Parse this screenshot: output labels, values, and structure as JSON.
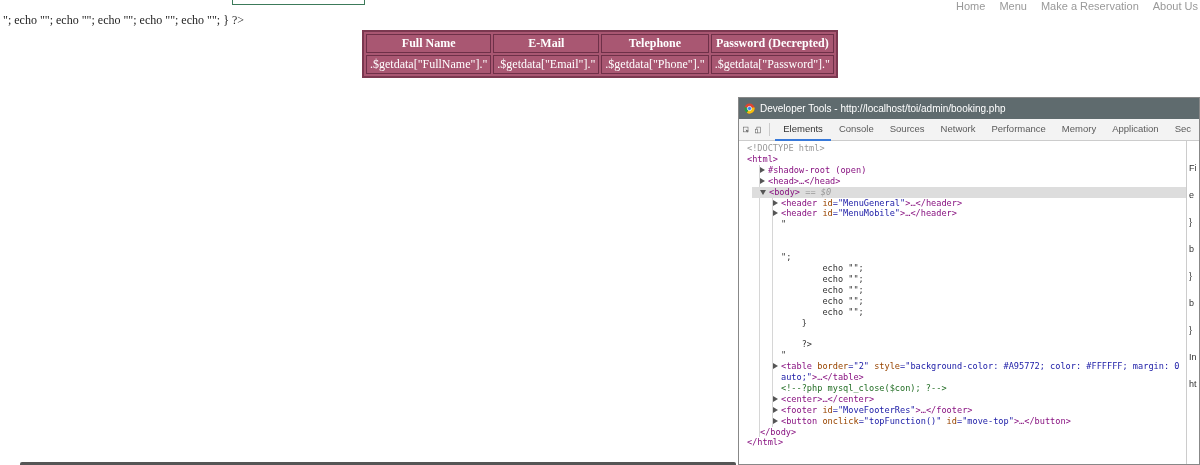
{
  "top_nav": [
    "Home",
    "Menu",
    "Make a Reservation",
    "About Us"
  ],
  "stray_text": "\"; echo \"\"; echo \"\"; echo \"\"; echo \"\"; echo \"\"; } ?>",
  "table": {
    "columns": [
      "Full Name",
      "E-Mail",
      "Telephone",
      "Password (Decrepted)"
    ],
    "rows": [
      [
        ".$getdata[\"FullName\"].\"",
        ".$getdata[\"Email\"].\"",
        ".$getdata[\"Phone\"].\"",
        ".$getdata[\"Password\"].\""
      ]
    ]
  },
  "devtools": {
    "title": "Developer Tools - http://localhost/toi/admin/booking.php",
    "tabs": [
      {
        "label": "Elements",
        "selected": true
      },
      {
        "label": "Console",
        "selected": false
      },
      {
        "label": "Sources",
        "selected": false
      },
      {
        "label": "Network",
        "selected": false
      },
      {
        "label": "Performance",
        "selected": false
      },
      {
        "label": "Memory",
        "selected": false
      },
      {
        "label": "Application",
        "selected": false
      },
      {
        "label": "Sec",
        "selected": false
      }
    ],
    "elements": [
      {
        "kind": "doctype",
        "text": "<!DOCTYPE html>",
        "selected": false
      },
      {
        "kind": "open",
        "open": "<html>",
        "selected": false,
        "children": [
          {
            "kind": "element",
            "open": "#shadow-root (open)",
            "expanded": false,
            "selected": false
          },
          {
            "kind": "element",
            "open": "<head>…</head>",
            "expanded": false,
            "selected": false
          },
          {
            "kind": "element",
            "open": "<body>",
            "suffix": "== $0",
            "expanded": true,
            "selected": true,
            "children": [
              {
                "kind": "element",
                "open": "<header",
                "attrs": [
                  {
                    "name": "id",
                    "value": "=\"MenuGeneral\""
                  }
                ],
                "close": ">…</header>",
                "expanded": false,
                "selected": false
              },
              {
                "kind": "element",
                "open": "<header",
                "attrs": [
                  {
                    "name": "id",
                    "value": "=\"MenuMobile\""
                  }
                ],
                "close": ">…</header>",
                "expanded": false,
                "selected": false
              },
              {
                "kind": "text",
                "text": "\"\n\n\n\";\n        echo \"\";\n        echo \"\";\n        echo \"\";\n        echo \"\";\n        echo \"\";\n    }\n\n    ?>\n\"",
                "selected": false
              },
              {
                "kind": "element",
                "open": "<table",
                "attrs": [
                  {
                    "name": "border",
                    "value": "=\"2\""
                  },
                  {
                    "name": "style",
                    "value": "=\"background-color: #A95772; color: #FFFFFF; margin: 0 auto;\""
                  }
                ],
                "close": ">…</table>",
                "expanded": false,
                "selected": false
              },
              {
                "kind": "comment",
                "text": "<!--?php mysql_close($con); ?-->",
                "selected": false
              },
              {
                "kind": "element",
                "open": "<center>…</center>",
                "expanded": false,
                "selected": false
              },
              {
                "kind": "element",
                "open": "<footer",
                "attrs": [
                  {
                    "name": "id",
                    "value": "=\"MoveFooterRes\""
                  }
                ],
                "close": ">…</footer>",
                "expanded": false,
                "selected": false
              },
              {
                "kind": "element",
                "open": "<button",
                "attrs": [
                  {
                    "name": "onclick",
                    "value": "=\"topFunction()\""
                  },
                  {
                    "name": "id",
                    "value": "=\"move-top\""
                  }
                ],
                "close": ">…</button>",
                "expanded": false,
                "selected": false
              }
            ]
          },
          {
            "kind": "closing",
            "text": "</body>",
            "selected": false
          }
        ]
      },
      {
        "kind": "closing",
        "text": "</html>",
        "selected": false
      }
    ],
    "side_panel": [
      "Fi",
      "e",
      "}",
      "b",
      "}",
      "b",
      "}",
      "In",
      "ht"
    ]
  }
}
